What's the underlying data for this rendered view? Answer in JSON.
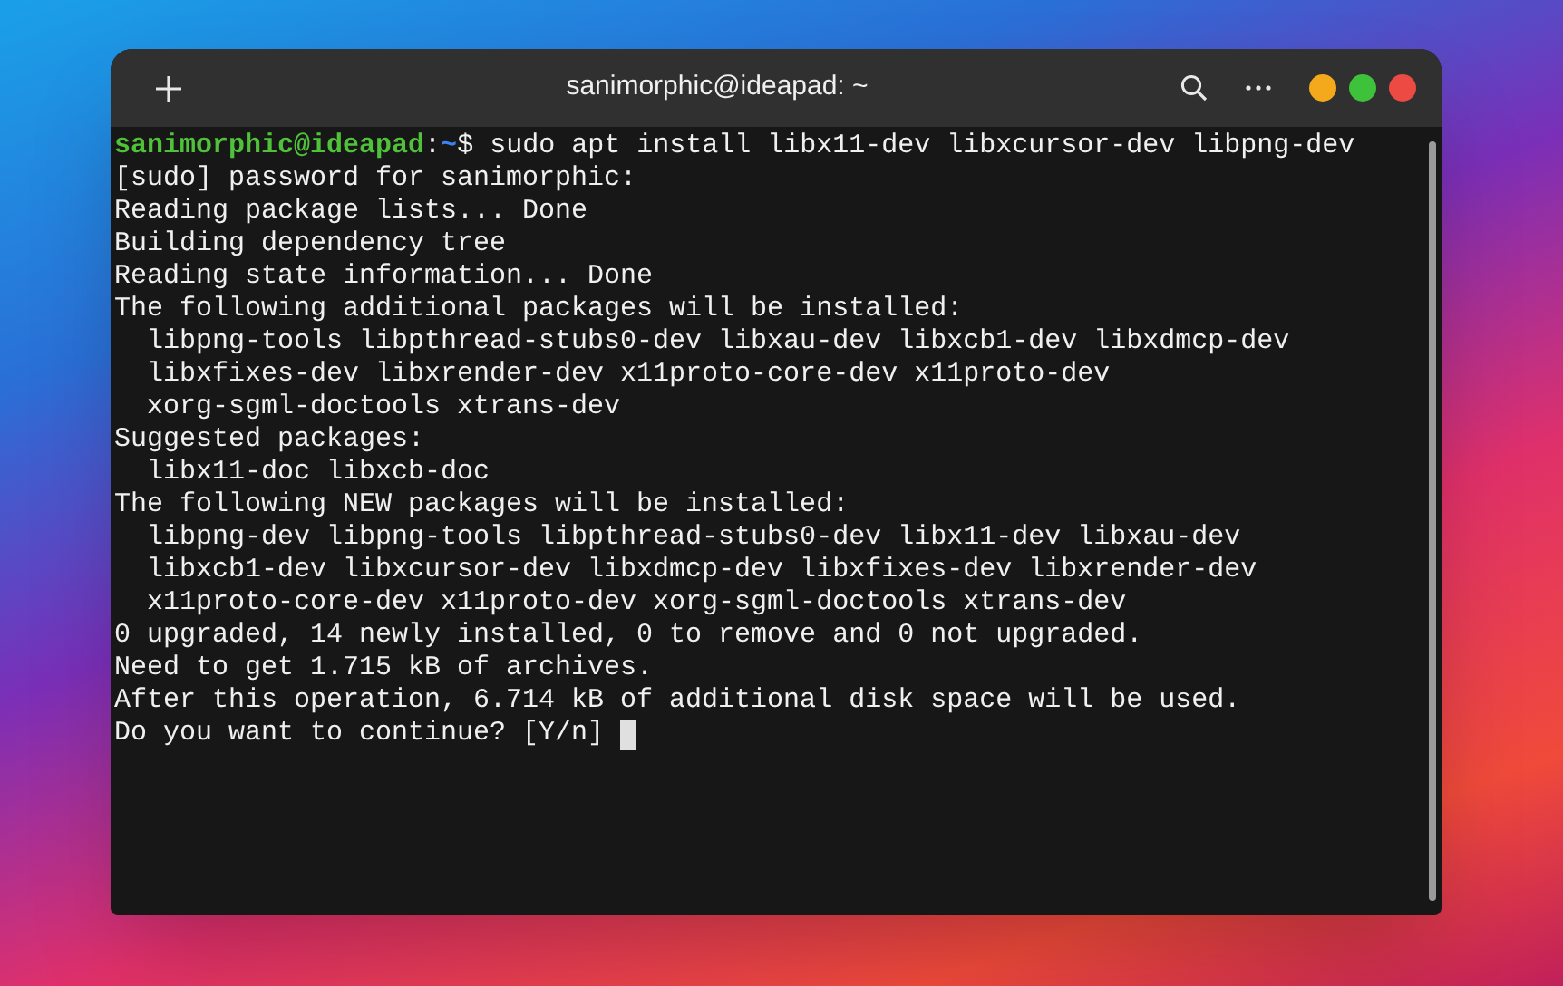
{
  "window": {
    "title": "sanimorphic@ideapad: ~"
  },
  "prompt": {
    "user_host": "sanimorphic@ideapad",
    "separator": ":",
    "path": "~",
    "symbol": "$",
    "command": "sudo apt install libx11-dev libxcursor-dev libpng-dev"
  },
  "output": [
    "[sudo] password for sanimorphic:",
    "Reading package lists... Done",
    "Building dependency tree",
    "Reading state information... Done",
    "The following additional packages will be installed:",
    "  libpng-tools libpthread-stubs0-dev libxau-dev libxcb1-dev libxdmcp-dev",
    "  libxfixes-dev libxrender-dev x11proto-core-dev x11proto-dev",
    "  xorg-sgml-doctools xtrans-dev",
    "Suggested packages:",
    "  libx11-doc libxcb-doc",
    "The following NEW packages will be installed:",
    "  libpng-dev libpng-tools libpthread-stubs0-dev libx11-dev libxau-dev",
    "  libxcb1-dev libxcursor-dev libxdmcp-dev libxfixes-dev libxrender-dev",
    "  x11proto-core-dev x11proto-dev xorg-sgml-doctools xtrans-dev",
    "0 upgraded, 14 newly installed, 0 to remove and 0 not upgraded.",
    "Need to get 1.715 kB of archives.",
    "After this operation, 6.714 kB of additional disk space will be used."
  ],
  "last_line": "Do you want to continue? [Y/n]"
}
